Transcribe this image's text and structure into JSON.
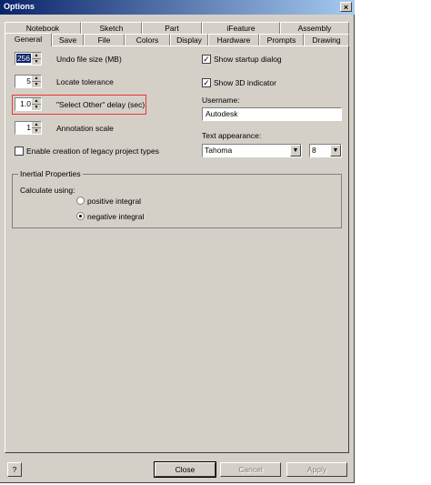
{
  "window": {
    "title": "Options",
    "close_glyph": "×"
  },
  "tabs_back": [
    "Notebook",
    "Sketch",
    "Part",
    "iFeature",
    "Assembly"
  ],
  "tabs_front": [
    "General",
    "Save",
    "File",
    "Colors",
    "Display",
    "Hardware",
    "Prompts",
    "Drawing"
  ],
  "general": {
    "undo_value": "256",
    "undo_label": "Undo file size (MB)",
    "locate_value": "5",
    "locate_label": "Locate tolerance",
    "select_other_value": "1.0",
    "select_other_label": "\"Select Other\" delay (sec)",
    "annotation_value": "1",
    "annotation_label": "Annotation scale",
    "legacy_label": "Enable creation of legacy project types",
    "show_startup_label": "Show startup dialog",
    "show_3d_label": "Show 3D indicator",
    "username_label": "Username:",
    "username_value": "Autodesk",
    "text_appearance_label": "Text appearance:",
    "font_value": "Tahoma",
    "size_value": "8"
  },
  "inertial": {
    "title": "Inertial Properties",
    "calc_label": "Calculate using:",
    "positive_label": "positive integral",
    "negative_label": "negative integral"
  },
  "buttons": {
    "help": "?",
    "close": "Close",
    "cancel": "Cancel",
    "apply": "Apply"
  }
}
